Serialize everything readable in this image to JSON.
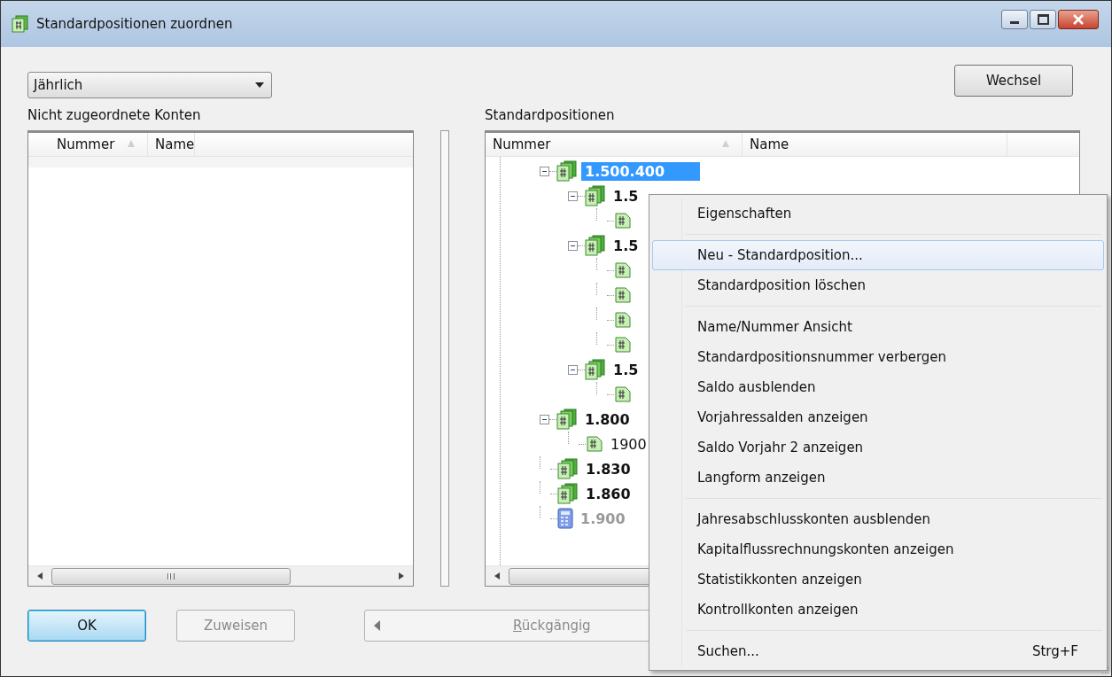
{
  "window": {
    "title": "Standardpositionen zuordnen"
  },
  "period_dropdown": {
    "value": "Jährlich"
  },
  "change_button": "Wechsel",
  "left_panel": {
    "label": "Nicht zugeordnete Konten",
    "columns": [
      "Nummer",
      "Name"
    ]
  },
  "right_panel": {
    "label": "Standardpositionen",
    "columns": [
      "Nummer",
      "Name"
    ],
    "tree": [
      {
        "label": "1.500.400",
        "kind": "group",
        "bold": true,
        "selected": true,
        "disabled": false,
        "expanded": true,
        "children": [
          {
            "label": "1.5",
            "kind": "group",
            "bold": true,
            "selected": false,
            "disabled": false,
            "expanded": true,
            "children": [
              {
                "kind": "leaf"
              }
            ]
          },
          {
            "label": "1.5",
            "kind": "group",
            "bold": true,
            "selected": false,
            "disabled": false,
            "expanded": true,
            "children": [
              {
                "kind": "leaf"
              },
              {
                "kind": "leaf"
              },
              {
                "kind": "leaf"
              },
              {
                "kind": "leaf"
              }
            ]
          },
          {
            "label": "1.5",
            "kind": "group",
            "bold": true,
            "selected": false,
            "disabled": false,
            "expanded": true,
            "children": [
              {
                "kind": "leaf"
              }
            ]
          }
        ]
      },
      {
        "label": "1.800",
        "kind": "group",
        "bold": true,
        "selected": false,
        "disabled": false,
        "expanded": true,
        "children": [
          {
            "label": "1900",
            "kind": "leaf",
            "bold": false,
            "selected": false,
            "disabled": false
          }
        ]
      },
      {
        "label": "1.830",
        "kind": "group",
        "bold": true,
        "selected": false,
        "disabled": false
      },
      {
        "label": "1.860",
        "kind": "group",
        "bold": true,
        "selected": false,
        "disabled": false
      },
      {
        "label": "1.900",
        "kind": "calculator",
        "bold": true,
        "selected": false,
        "disabled": true
      }
    ]
  },
  "buttons": [
    {
      "label": "OK",
      "kind": "default",
      "disabled": false
    },
    {
      "label": "Zuweisen",
      "kind": "normal",
      "disabled": true
    }
  ],
  "undo_button": {
    "label": "Rückgängig",
    "disabled": true
  },
  "context_menu": {
    "groups": [
      [
        {
          "label": "Eigenschaften",
          "selected": false
        }
      ],
      [
        {
          "label": "Neu - Standardposition...",
          "selected": true
        },
        {
          "label": "Standardposition löschen",
          "selected": false
        }
      ],
      [
        {
          "label": "Name/Nummer Ansicht",
          "selected": false
        },
        {
          "label": "Standardpositionsnummer verbergen",
          "selected": false
        },
        {
          "label": "Saldo ausblenden",
          "selected": false
        },
        {
          "label": "Vorjahressalden anzeigen",
          "selected": false
        },
        {
          "label": "Saldo Vorjahr 2 anzeigen",
          "selected": false
        },
        {
          "label": "Langform anzeigen",
          "selected": false
        }
      ],
      [
        {
          "label": "Jahresabschlusskonten ausblenden",
          "selected": false
        },
        {
          "label": "Kapitalflussrechnungskonten anzeigen",
          "selected": false
        },
        {
          "label": "Statistikkonten anzeigen",
          "selected": false
        },
        {
          "label": "Kontrollkonten anzeigen",
          "selected": false
        }
      ],
      [
        {
          "label": "Suchen...",
          "shortcut": "Strg+F",
          "selected": false
        }
      ]
    ]
  }
}
